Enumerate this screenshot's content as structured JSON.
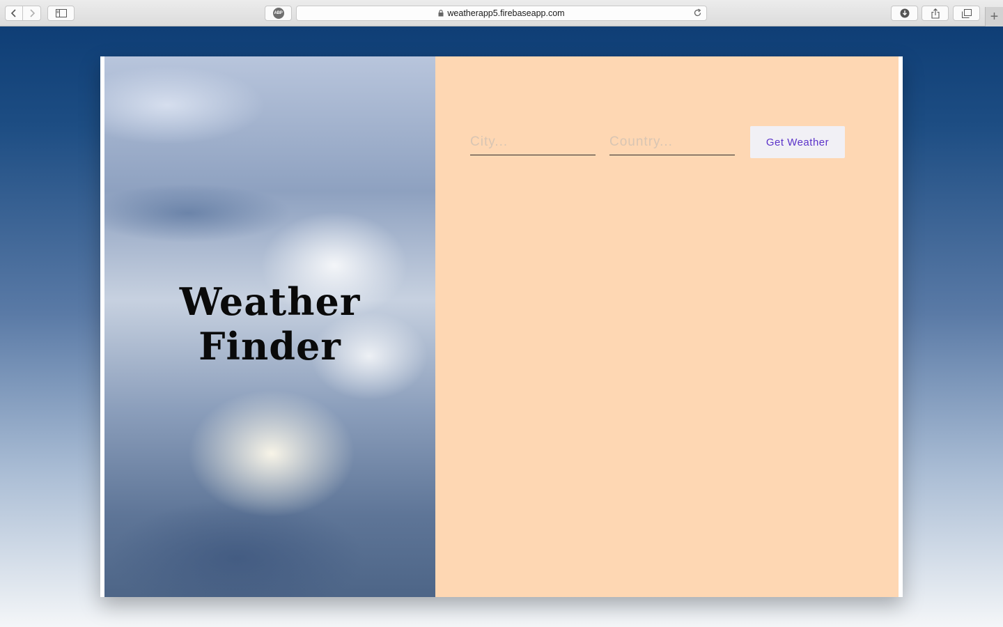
{
  "browser": {
    "url": "weatherapp5.firebaseapp.com",
    "abp_label": "ABP",
    "icons": {
      "back": "chevron-left-icon",
      "forward": "chevron-right-icon",
      "sidebar": "sidebar-icon",
      "lock": "lock-icon",
      "reload": "reload-icon",
      "download": "download-icon",
      "share": "share-icon",
      "tabs": "tabs-icon",
      "new_tab": "plus-icon"
    }
  },
  "hero": {
    "title": "Weather Finder"
  },
  "form": {
    "city_placeholder": "City...",
    "country_placeholder": "Country...",
    "city_value": "",
    "country_value": "",
    "submit_label": "Get Weather"
  },
  "colors": {
    "page_background_top": "#0b3a72",
    "panel_background": "#fed7b3",
    "button_background": "#f1f0f5",
    "button_text": "#5b32c9"
  }
}
